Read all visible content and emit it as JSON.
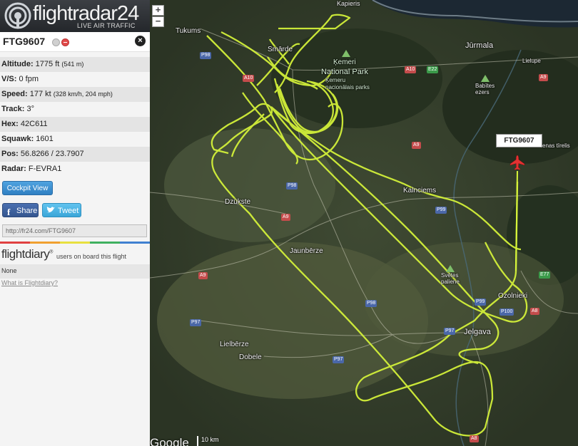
{
  "app": {
    "logo_name": "flightradar24",
    "logo_sub": "LIVE AIR TRAFFIC"
  },
  "flight": {
    "callsign": "FTG9607",
    "rows": [
      {
        "label": "Altitude:",
        "value": "1775 ft",
        "extra": "(541 m)"
      },
      {
        "label": "V/S:",
        "value": "0 fpm",
        "extra": ""
      },
      {
        "label": "Speed:",
        "value": "177 kt",
        "extra": "(328 km/h, 204 mph)"
      },
      {
        "label": "Track:",
        "value": "3°",
        "extra": ""
      },
      {
        "label": "Hex:",
        "value": "42C611",
        "extra": ""
      },
      {
        "label": "Squawk:",
        "value": "1601",
        "extra": ""
      },
      {
        "label": "Pos:",
        "value": "56.8266 / 23.7907",
        "extra": ""
      },
      {
        "label": "Radar:",
        "value": "F-EVRA1",
        "extra": ""
      }
    ],
    "cockpit_button": "Cockpit View",
    "share_button": "Share",
    "tweet_button": "Tweet",
    "share_url": "http://fr24.com/FTG9607"
  },
  "flightdiary": {
    "logo": "flightdiary",
    "tagline": "users on board this flight",
    "value": "None",
    "link": "What is Flightdiary?"
  },
  "map": {
    "zoom_in": "+",
    "zoom_out": "−",
    "aircraft_label": "FTG9607",
    "scale_label": "10 km",
    "attribution": "Google",
    "places": {
      "kapieris": "Kapieris",
      "tukums": "Tukums",
      "smarde": "Smārde",
      "jurmala": "Jūrmala",
      "lielupe": "Lielupe",
      "kemeri": "Ķemeri",
      "national_park": "National Park",
      "kemeri_sub": "Ķemeru nacionālais parks",
      "babites": "Babītes ezers",
      "jenas": "enas tīrelis",
      "kalnciems": "Kalnciems",
      "dzukste": "Dzūkste",
      "jaunberze": "Jaunbērze",
      "svetes": "Svētes paliene",
      "ozolnieki": "Ozolnieki",
      "jelgava": "Jelgava",
      "lielberze": "Lielbērze",
      "dobele": "Dobele"
    },
    "roads": {
      "p98a": "P98",
      "a10a": "A10",
      "a10b": "A10",
      "e22": "E22",
      "a9a": "A9",
      "a9b": "A9",
      "p98b": "P98",
      "a9c": "A9",
      "p99a": "P99",
      "a9d": "A9",
      "e77": "E77",
      "p98c": "P98",
      "p99b": "P99",
      "p100": "P100",
      "a8a": "A8",
      "p97a": "P97",
      "p97b": "P97",
      "p97c": "P97",
      "a8b": "A8"
    }
  }
}
